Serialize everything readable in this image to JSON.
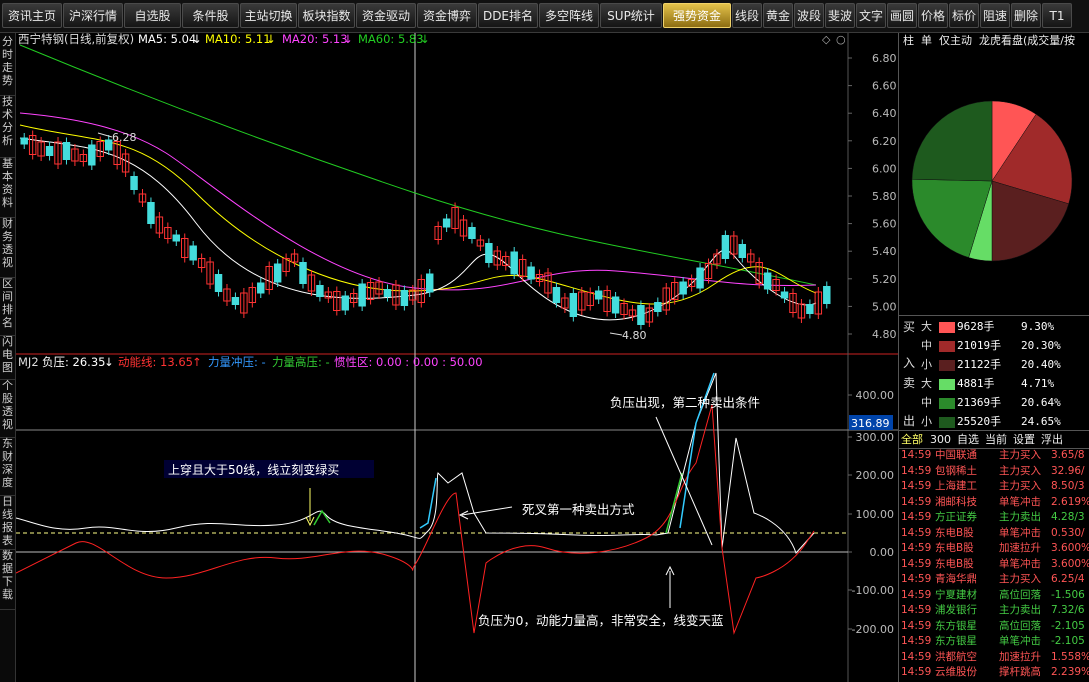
{
  "nav": {
    "items": [
      "资讯主页",
      "沪深行情",
      "自选股",
      "条件股",
      "主站切换",
      "板块指数",
      "资金驱动",
      "资金博弈",
      "DDE排名",
      "多空阵线",
      "SUP统计",
      "强势资金",
      "线段",
      "黄金",
      "波段",
      "斐波",
      "文字",
      "画圆",
      "价格",
      "标价",
      "阻速",
      "删除",
      "T1"
    ],
    "active_index": 11
  },
  "left_tabs": [
    "分时走势",
    "技术分析",
    "基本资料",
    "财务透视",
    "区间排名",
    "闪电图",
    "个股透视",
    "东财深度",
    "日线报表",
    "数据下载"
  ],
  "chart_header": {
    "stock": "西宁特钢(日线,前复权)",
    "ma5_label": "MA5: 5.04",
    "ma5_arrow": "↓",
    "ma10_label": "MA10: 5.11",
    "ma10_arrow": "↓",
    "ma20_label": "MA20: 5.13",
    "ma20_arrow": "↓",
    "ma60_label": "MA60: 5.83",
    "ma60_arrow": "↓",
    "colors": {
      "ma5": "#ffffff",
      "ma10": "#ffff00",
      "ma20": "#ff44ff",
      "ma60": "#22cc22"
    }
  },
  "price_axis": [
    "6.80",
    "6.60",
    "6.40",
    "6.20",
    "6.00",
    "5.80",
    "5.60",
    "5.40",
    "5.20",
    "5.00",
    "4.80"
  ],
  "price_annotations": {
    "high": "6.28",
    "low": "4.80"
  },
  "indicator_header": {
    "name": "MJ2",
    "fuya": "负压: 26.35",
    "fuya_arrow": "↓",
    "dongneng": "动能线: 13.65",
    "dongneng_arrow": "↑",
    "lichong": "力量冲压: -",
    "ligaoya": "力量高压: -",
    "guanxing": "惯性区: 0.00 : 0.00 : 50.00"
  },
  "indicator_axis": [
    "400.00",
    "300.00",
    "200.00",
    "100.00",
    "0.00",
    "-100.00",
    "-200.00"
  ],
  "current_value": "316.89",
  "annotations": {
    "a1": "上穿且大于50线，线立刻变绿买",
    "a2": "死叉第一种卖出方式",
    "a3": "负压出现，第二种卖出条件",
    "a4": "负压为0，动能力量高，非常安全，线变天蓝"
  },
  "right_panel": {
    "tabs": [
      "柱",
      "单",
      "仅主动",
      "龙虎看盘(成交量/按"
    ],
    "buy_label": "买",
    "sell_label": "卖",
    "in_label": "入",
    "out_label": "出",
    "buy_rows": [
      {
        "size": "大",
        "volume": "9628手",
        "pct": "9.30%",
        "color": "#ff5555"
      },
      {
        "size": "中",
        "volume": "21019手",
        "pct": "20.30%",
        "color": "#a02a2a"
      },
      {
        "size": "小",
        "volume": "21122手",
        "pct": "20.40%",
        "color": "#5a1f1f"
      }
    ],
    "sell_rows": [
      {
        "size": "大",
        "volume": "4881手",
        "pct": "4.71%",
        "color": "#66dd66"
      },
      {
        "size": "中",
        "volume": "21369手",
        "pct": "20.64%",
        "color": "#2b8a2b"
      },
      {
        "size": "小",
        "volume": "25520手",
        "pct": "24.65%",
        "color": "#1e5a1e"
      }
    ],
    "list_tabs": [
      "全部",
      "300",
      "自选",
      "当前",
      "设置",
      "浮出"
    ],
    "ticks": [
      {
        "time": "14:59",
        "name": "中国联通",
        "action": "主力买入",
        "val": "3.65/8",
        "color": "#ff5555"
      },
      {
        "time": "14:59",
        "name": "包钢稀土",
        "action": "主力买入",
        "val": "32.96/",
        "color": "#ff5555"
      },
      {
        "time": "14:59",
        "name": "上海建工",
        "action": "主力买入",
        "val": "8.50/3",
        "color": "#ff5555"
      },
      {
        "time": "14:59",
        "name": "湘邮科技",
        "action": "单笔冲击",
        "val": "2.619%",
        "color": "#ff5555"
      },
      {
        "time": "14:59",
        "name": "方正证券",
        "action": "主力卖出",
        "val": "4.28/3",
        "color": "#44cc44"
      },
      {
        "time": "14:59",
        "name": "东电B股",
        "action": "单笔冲击",
        "val": "0.530/",
        "color": "#ff5555"
      },
      {
        "time": "14:59",
        "name": "东电B股",
        "action": "加速拉升",
        "val": "3.600%",
        "color": "#ff5555"
      },
      {
        "time": "14:59",
        "name": "东电B股",
        "action": "单笔冲击",
        "val": "3.600%",
        "color": "#ff5555"
      },
      {
        "time": "14:59",
        "name": "青海华鼎",
        "action": "主力买入",
        "val": "6.25/4",
        "color": "#ff5555"
      },
      {
        "time": "14:59",
        "name": "宁夏建材",
        "action": "高位回落",
        "val": "-1.506",
        "color": "#44cc44"
      },
      {
        "time": "14:59",
        "name": "浦发银行",
        "action": "主力卖出",
        "val": "7.32/6",
        "color": "#44cc44"
      },
      {
        "time": "14:59",
        "name": "东方银星",
        "action": "高位回落",
        "val": "-2.105",
        "color": "#44cc44"
      },
      {
        "time": "14:59",
        "name": "东方银星",
        "action": "单笔冲击",
        "val": "-2.105",
        "color": "#44cc44"
      },
      {
        "time": "14:59",
        "name": "洪都航空",
        "action": "加速拉升",
        "val": "1.558%",
        "color": "#ff5555"
      },
      {
        "time": "14:59",
        "name": "云维股份",
        "action": "撑杆跳高",
        "val": "2.239%",
        "color": "#ff5555"
      }
    ]
  }
}
